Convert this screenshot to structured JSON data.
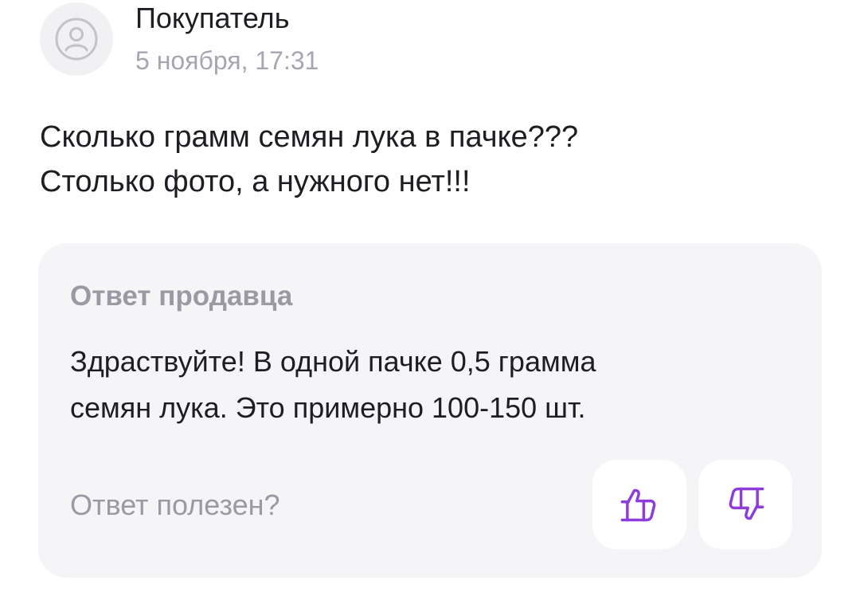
{
  "review": {
    "author": "Покупатель",
    "date": "5 ноября, 17:31",
    "question_lines": [
      "Сколько грамм семян лука в пачке???",
      "Столько фото, а нужного нет!!!"
    ]
  },
  "answer": {
    "title": "Ответ продавца",
    "text_lines": [
      "Здраствуйте! В одной пачке 0,5 грамма",
      "семян лука. Это примерно 100-150 шт."
    ],
    "helpful_prompt": "Ответ полезен?"
  },
  "icons": {
    "avatar": "user-icon",
    "like": "thumbs-up-icon",
    "dislike": "thumbs-down-icon"
  },
  "colors": {
    "accent": "#8e3ddc",
    "card_background": "#f5f5f8",
    "muted_text": "#9a9aa5"
  }
}
